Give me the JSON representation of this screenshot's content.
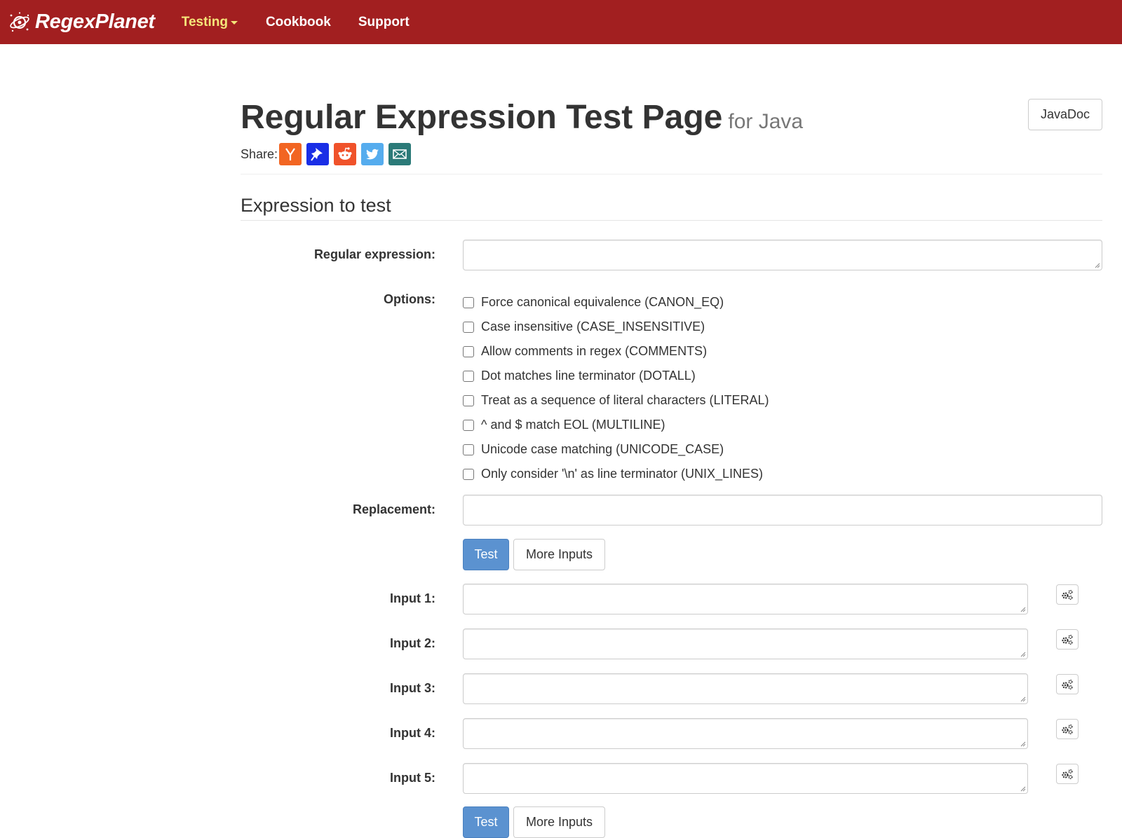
{
  "navbar": {
    "brand": "RegexPlanet",
    "items": [
      {
        "label": "Testing",
        "has_dropdown": true,
        "color": "#f5e67a"
      },
      {
        "label": "Cookbook"
      },
      {
        "label": "Support"
      }
    ],
    "background": "#a21f20"
  },
  "header": {
    "title": "Regular Expression Test Page",
    "subtitle": "for Java",
    "javadoc_label": "JavaDoc",
    "share_label": "Share:",
    "share_buttons": [
      {
        "icon": "hacker-news-icon",
        "color": "#f26522"
      },
      {
        "icon": "pinboard-icon",
        "color": "#0000e6"
      },
      {
        "icon": "reddit-icon",
        "color": "#ff4500"
      },
      {
        "icon": "twitter-icon",
        "color": "#55acee"
      },
      {
        "icon": "email-icon",
        "color": "#2b7a78"
      }
    ]
  },
  "section": {
    "title": "Expression to test"
  },
  "form": {
    "regex_label": "Regular expression:",
    "regex_value": "",
    "options_label": "Options:",
    "options": [
      {
        "label": "Force canonical equivalence (CANON_EQ)",
        "checked": false
      },
      {
        "label": "Case insensitive (CASE_INSENSITIVE)",
        "checked": false
      },
      {
        "label": "Allow comments in regex (COMMENTS)",
        "checked": false
      },
      {
        "label": "Dot matches line terminator (DOTALL)",
        "checked": false
      },
      {
        "label": "Treat as a sequence of literal characters (LITERAL)",
        "checked": false
      },
      {
        "label": "^ and $ match EOL (MULTILINE)",
        "checked": false
      },
      {
        "label": "Unicode case matching (UNICODE_CASE)",
        "checked": false
      },
      {
        "label": "Only consider '\\n' as line terminator (UNIX_LINES)",
        "checked": false
      }
    ],
    "replacement_label": "Replacement:",
    "replacement_value": "",
    "test_label": "Test",
    "more_inputs_label": "More Inputs",
    "inputs": [
      {
        "label": "Input 1:",
        "value": ""
      },
      {
        "label": "Input 2:",
        "value": ""
      },
      {
        "label": "Input 3:",
        "value": ""
      },
      {
        "label": "Input 4:",
        "value": ""
      },
      {
        "label": "Input 5:",
        "value": ""
      }
    ]
  }
}
